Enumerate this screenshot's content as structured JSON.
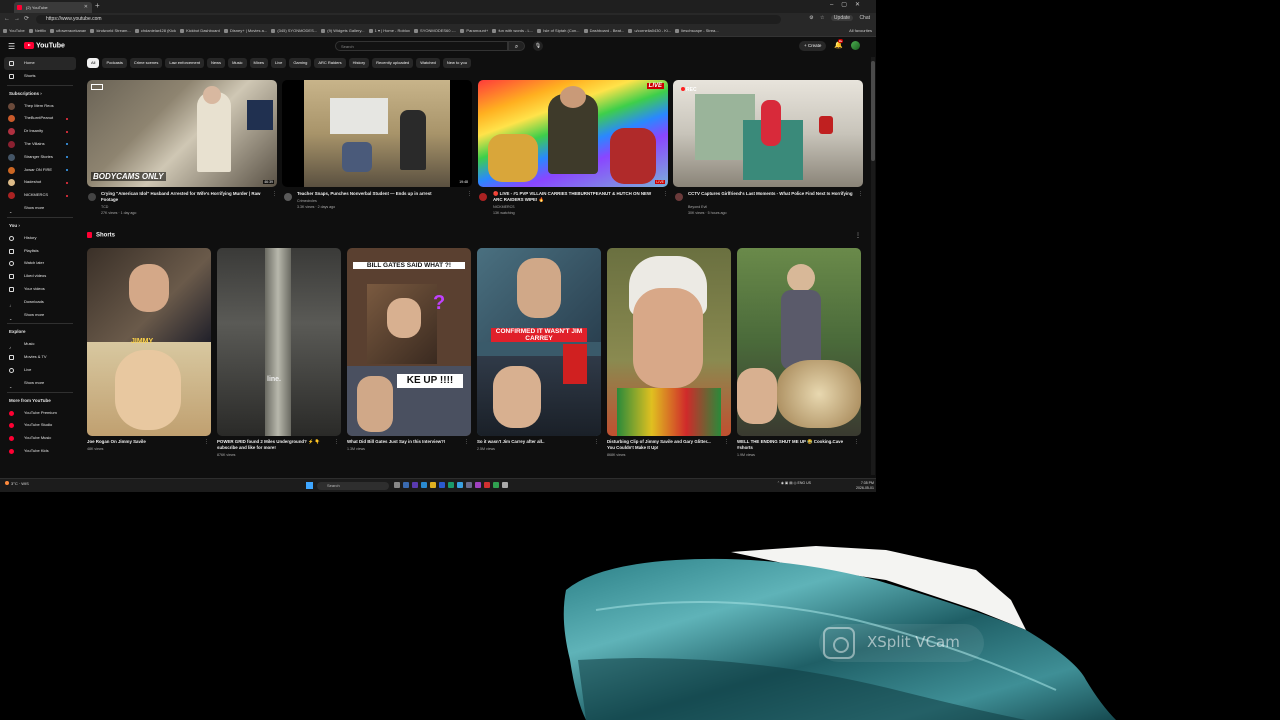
{
  "browser": {
    "tab_title": "(2) YouTube",
    "url": "https://www.youtube.com",
    "update_label": "Update",
    "chat_label": "Chat",
    "bookmarks": [
      "YouTube",
      "Netflix",
      "",
      "ufloweracekanan",
      "kindworld Stream...",
      "chdanielar428 (Kick",
      "Kickbot Dashboard",
      "Disney+ | Movies a...",
      "(345) SYONMODES...",
      "(9) Widgets Gallery...",
      "1 ▾ | Home - Roblox",
      "SYONMODES60 -...",
      "Paramount+",
      "fun with words - L...",
      "Isle of Siptah (Con...",
      "Dashboard - Beat...",
      "u/cornelia0430 - Ki...",
      "lieschscape - Strea..."
    ],
    "bookmarks_right": "All favourites"
  },
  "youtube": {
    "logo": "YouTube",
    "search_placeholder": "Search",
    "create_label": "Create",
    "notifications": "9+"
  },
  "sidebar": {
    "top": [
      {
        "label": "Home",
        "name": "home"
      },
      {
        "label": "Shorts",
        "name": "shorts"
      }
    ],
    "subscriptions_title": "Subscriptions ›",
    "subscriptions": [
      {
        "label": "Thep Mem Reos",
        "color": "#6b4a3a"
      },
      {
        "label": "TheBurntPeanut",
        "color": "#c95a2a"
      },
      {
        "label": "Dr Insanity",
        "color": "#b03040"
      },
      {
        "label": "The Villains",
        "color": "#8a2030"
      },
      {
        "label": "Stranger Stories",
        "color": "#445566"
      },
      {
        "label": "Jowar ON FIRE",
        "color": "#cc6622"
      },
      {
        "label": "Nadeshot",
        "color": "#ddbb88"
      },
      {
        "label": "NICKMERCS",
        "color": "#aa2222"
      },
      {
        "label": "Show more",
        "color": ""
      }
    ],
    "you_title": "You ›",
    "you": [
      "History",
      "Playlists",
      "Watch later",
      "Liked videos",
      "Your videos",
      "Downloads",
      "Show more"
    ],
    "explore_title": "Explore",
    "explore": [
      "Music",
      "Movies & TV",
      "Live",
      "Show more"
    ],
    "more_title": "More from YouTube",
    "more": [
      "YouTube Premium",
      "YouTube Studio",
      "YouTube Music",
      "YouTube Kids"
    ]
  },
  "chips": [
    "All",
    "Podcasts",
    "Crime scenes",
    "Law enforcement",
    "News",
    "Music",
    "Mixes",
    "Live",
    "Gaming",
    "ARC Raiders",
    "History",
    "Recently uploaded",
    "Watched",
    "New to you"
  ],
  "videos": [
    {
      "title": "Crying \"American Idol\" Husband Arrested for Wife's Horrifying Murder | Raw Footage",
      "channel": "TCD",
      "stats": "27K views · 1 day ago",
      "duration": "46:39",
      "overlay": "BODYCAMS ONLY"
    },
    {
      "title": "Teacher Snaps, Punches Nonverbal Student — Ends up in arrest",
      "channel": "Crimecircles",
      "stats": "3.3K views · 2 days ago",
      "duration": "19:48",
      "overlay": ""
    },
    {
      "title": "🔴 LIVE - #1 PVP VILLAIN CARRIES THEBURNTPEANUT & HUTCH ON NEW ARC RAIDERS WIPE! 🔥",
      "channel": "NICKMERCS",
      "stats": "13K watching",
      "duration": "LIVE",
      "overlay": "LIVE"
    },
    {
      "title": "CCTV Captures Girlfriend's Last Moments - What Police Find Next Is Horrifying",
      "channel": "Beyond Evil",
      "stats": "30K views · 5 hours ago",
      "duration": "",
      "overlay": "REC"
    }
  ],
  "shorts_title": "Shorts",
  "shorts": [
    {
      "title": "Joe Rogan On Jimmy Savile",
      "views": "48K views",
      "overlay": "JIMMY"
    },
    {
      "title": "POWER GRID found 2 Miles Underground? ⚡ 👇 subscribe and like for more!",
      "views": "876K views",
      "overlay": "line."
    },
    {
      "title": "What Did Bill Gates Just Say in this Interview?!",
      "views": "1.3M views",
      "overlay": "BILL GATES SAID WHAT ?!"
    },
    {
      "title": "So it wasn't Jim Carrey after all..",
      "views": "2.5M views",
      "overlay": "CONFIRMED IT WASN'T JIM CARREY"
    },
    {
      "title": "Disturbing Clip of Jimmy Savile and Gary Glitter... You Couldn't Make It Up!",
      "views": "868K views",
      "overlay": ""
    },
    {
      "title": "WELL THE ENDING SHUT ME UP 😂 Cooking.Cave #shorts",
      "views": "1.9M views",
      "overlay": ""
    }
  ],
  "taskbar": {
    "weather": "3°C · WIS",
    "search": "Search",
    "clock_time": "7:35 PM",
    "clock_date": "2026-05-01",
    "lang": "ENG US"
  },
  "webcam": {
    "watermark": "XSplit VCam"
  }
}
